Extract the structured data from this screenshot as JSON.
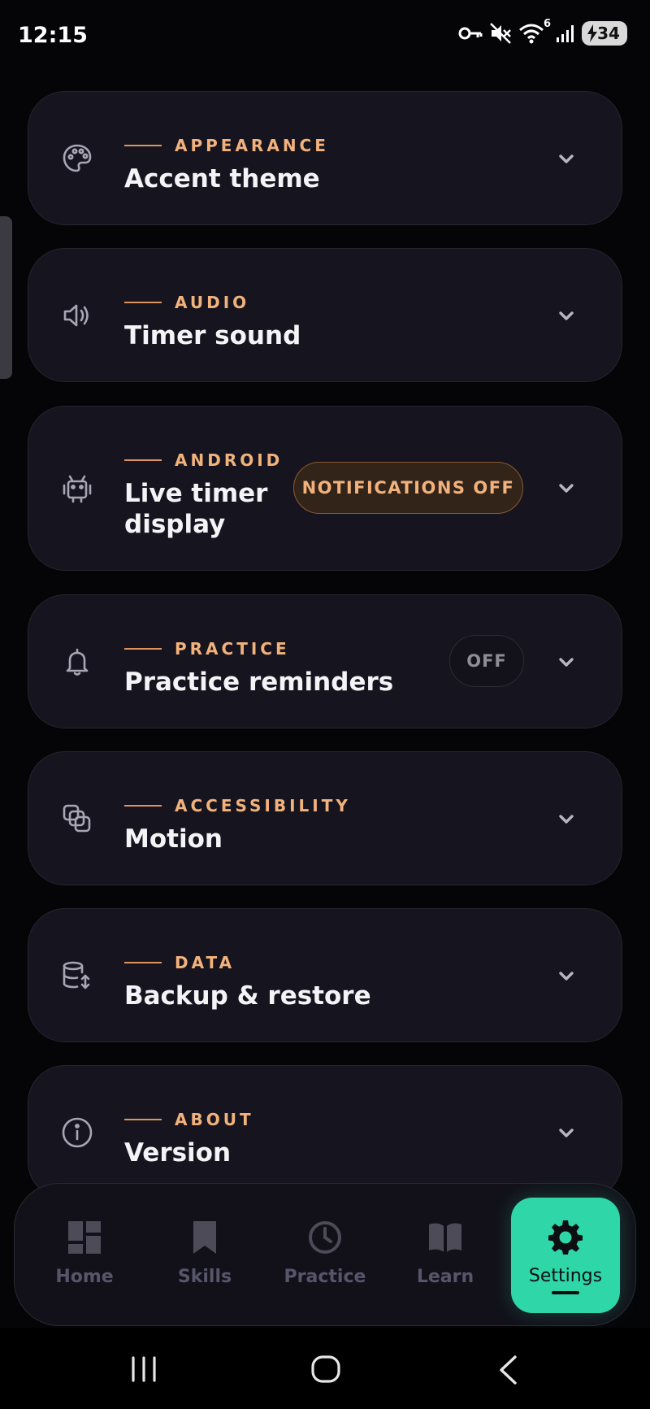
{
  "status_bar": {
    "time": "12:15",
    "network_badge": "6",
    "battery_level": "34"
  },
  "settings": [
    {
      "icon": "palette-icon",
      "category": "APPEARANCE",
      "title": "Accent theme"
    },
    {
      "icon": "speaker-icon",
      "category": "AUDIO",
      "title": "Timer sound"
    },
    {
      "icon": "android-icon",
      "category": "ANDROID",
      "title_line1": "Live timer",
      "title_line2": "display",
      "badge": "NOTIFICATIONS OFF"
    },
    {
      "icon": "bell-icon",
      "category": "PRACTICE",
      "title": "Practice reminders",
      "badge": "OFF"
    },
    {
      "icon": "layers-icon",
      "category": "ACCESSIBILITY",
      "title": "Motion"
    },
    {
      "icon": "database-icon",
      "category": "DATA",
      "title": "Backup & restore"
    },
    {
      "icon": "info-icon",
      "category": "ABOUT",
      "title": "Version"
    }
  ],
  "nav": [
    {
      "label": "Home",
      "icon": "dashboard-icon"
    },
    {
      "label": "Skills",
      "icon": "bookmark-icon"
    },
    {
      "label": "Practice",
      "icon": "clock-icon"
    },
    {
      "label": "Learn",
      "icon": "book-icon"
    },
    {
      "label": "Settings",
      "icon": "gear-icon",
      "active": true
    }
  ],
  "colors": {
    "accent": "#2fd6a8",
    "category": "#f2b27c",
    "card": "#16151f",
    "background": "#050507"
  }
}
